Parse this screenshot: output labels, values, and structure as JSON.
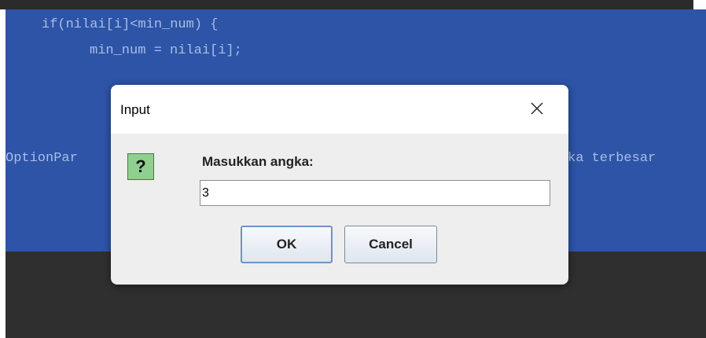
{
  "editor": {
    "lines": [
      "if(nilai[i]<min_num) {",
      "min_num = nilai[i];",
      "OptionPar",
      "ka terbesar"
    ]
  },
  "dialog": {
    "title": "Input",
    "icon": "question-icon",
    "icon_glyph": "?",
    "prompt": "Masukkan angka:",
    "input_value": "3",
    "ok_label": "OK",
    "cancel_label": "Cancel"
  }
}
